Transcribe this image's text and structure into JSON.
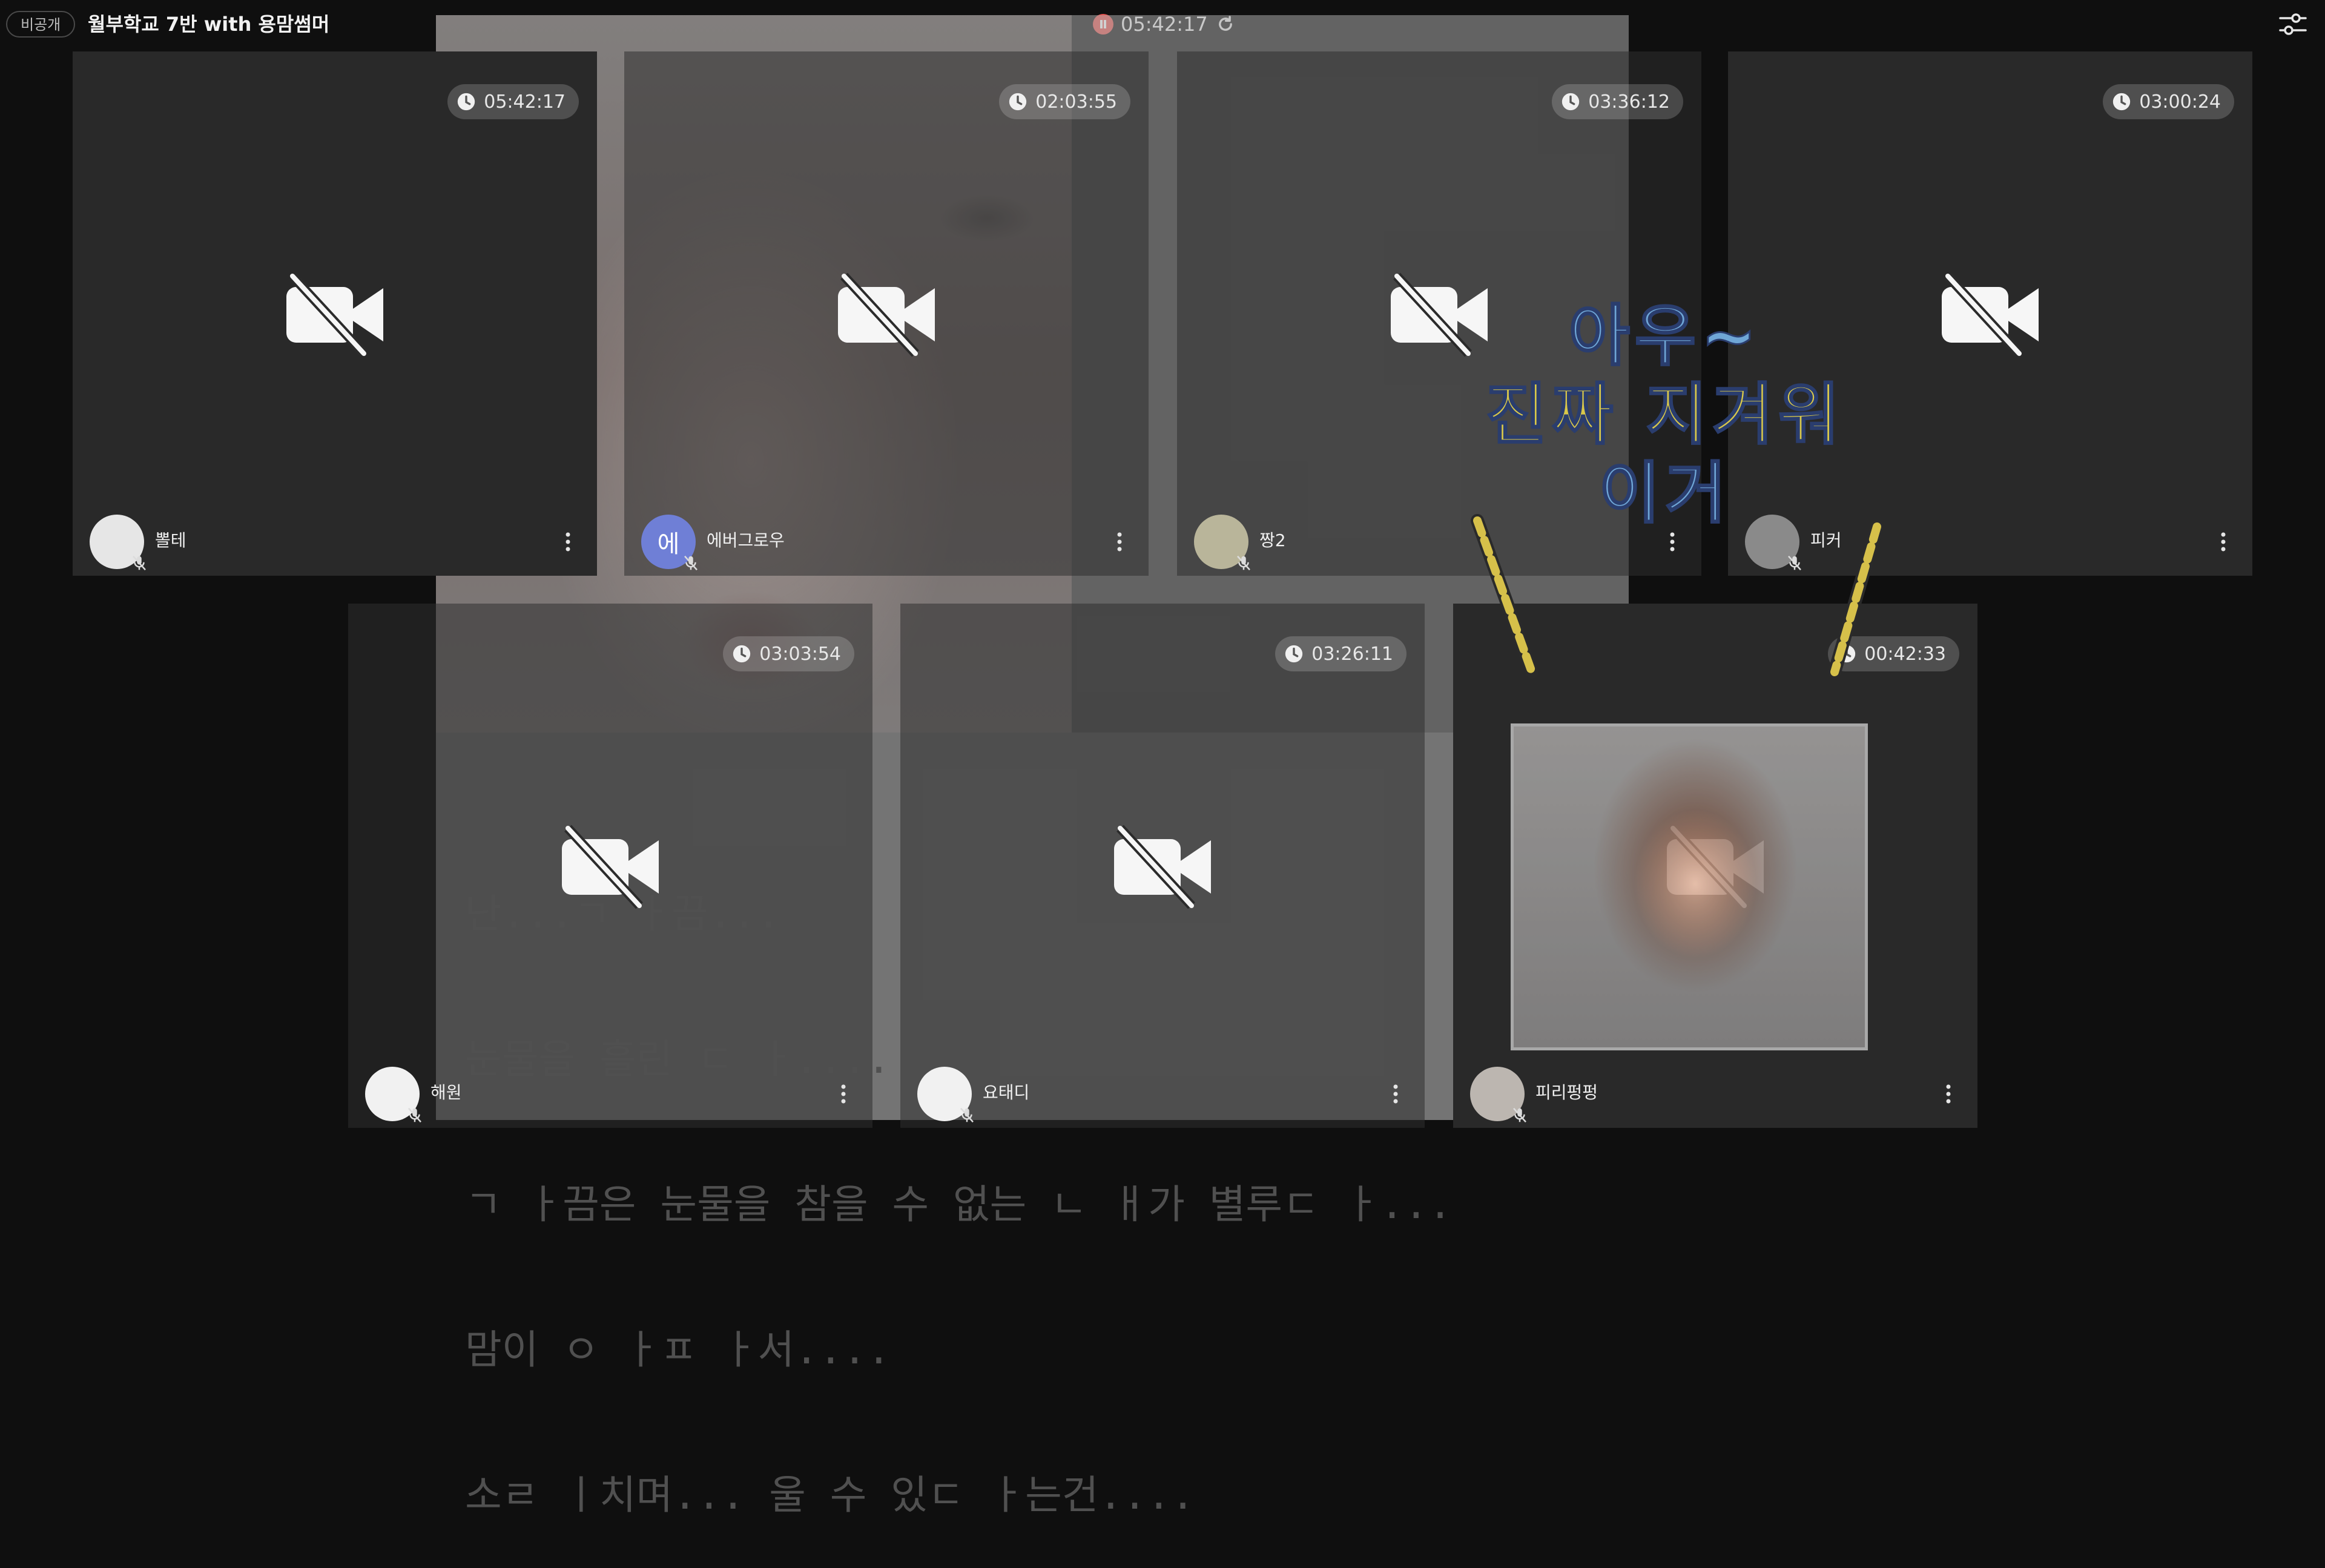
{
  "header": {
    "privacy_badge": "비공개",
    "room_title": "월부학교 7반 with 용맘썸머",
    "session_time": "05:42:17",
    "pause_icon": "pause-icon",
    "refresh_icon": "refresh-icon",
    "settings_icon": "settings-sliders-icon"
  },
  "overlay": {
    "caption_lines": [
      "난...ㄱ ㅏ끔...",
      "눈물을 흘린 ㄷ ㅏ....",
      "ㄱ ㅏ끔은 눈물을 참을 수 없는 ㄴ ㅐ가 별루ㄷ ㅏ...",
      "맘이 ㅇ ㅏㅍ ㅏ서....",
      "소ㄹ ㅣ치며... 울 수 있ㄷ ㅏ는건...."
    ],
    "sticker_lines": [
      "아우~",
      "진짜 지겨워",
      "이거"
    ]
  },
  "tiles": [
    {
      "name": "뽈테",
      "timer": "05:42:17",
      "avatar_color": "#e6e6e6",
      "avatar_letter": ""
    },
    {
      "name": "에버그로우",
      "timer": "02:03:55",
      "avatar_color": "#6f7fd6",
      "avatar_letter": "에"
    },
    {
      "name": "짱2",
      "timer": "03:36:12",
      "avatar_color": "#b9b59a",
      "avatar_letter": ""
    },
    {
      "name": "피커",
      "timer": "03:00:24",
      "avatar_color": "#8a8a8a",
      "avatar_letter": ""
    },
    {
      "name": "해원",
      "timer": "03:03:54",
      "avatar_color": "#f1f1f1",
      "avatar_letter": ""
    },
    {
      "name": "요태디",
      "timer": "03:26:11",
      "avatar_color": "#f1f1f1",
      "avatar_letter": ""
    },
    {
      "name": "피리펑펑",
      "timer": "00:42:33",
      "avatar_color": "#bcb6b0",
      "avatar_letter": ""
    }
  ],
  "icons": {
    "camera_off": "video-camera-off-icon",
    "clock": "clock-icon",
    "mic_off": "mic-off-icon",
    "more": "kebab-menu-icon"
  }
}
